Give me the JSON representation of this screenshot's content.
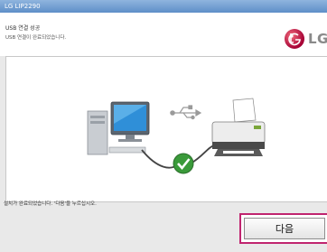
{
  "window": {
    "title": "LG LIP2290"
  },
  "header": {
    "heading": "USB 연결 성공",
    "subheading": "USB 연결이 완료되었습니다.",
    "logo_text": "LG"
  },
  "illustration": {
    "icons": [
      "computer-icon",
      "usb-icon",
      "checkmark-icon",
      "printer-icon"
    ]
  },
  "footer": {
    "status_text": "설치가 완료되었습니다. '다음'을 누르십시오.",
    "next_label": "다음"
  },
  "colors": {
    "titlebar": "#6f9ad2",
    "lg_brand": "#a50034",
    "focus_border": "#c0246f",
    "check": "#3a9a3a"
  }
}
